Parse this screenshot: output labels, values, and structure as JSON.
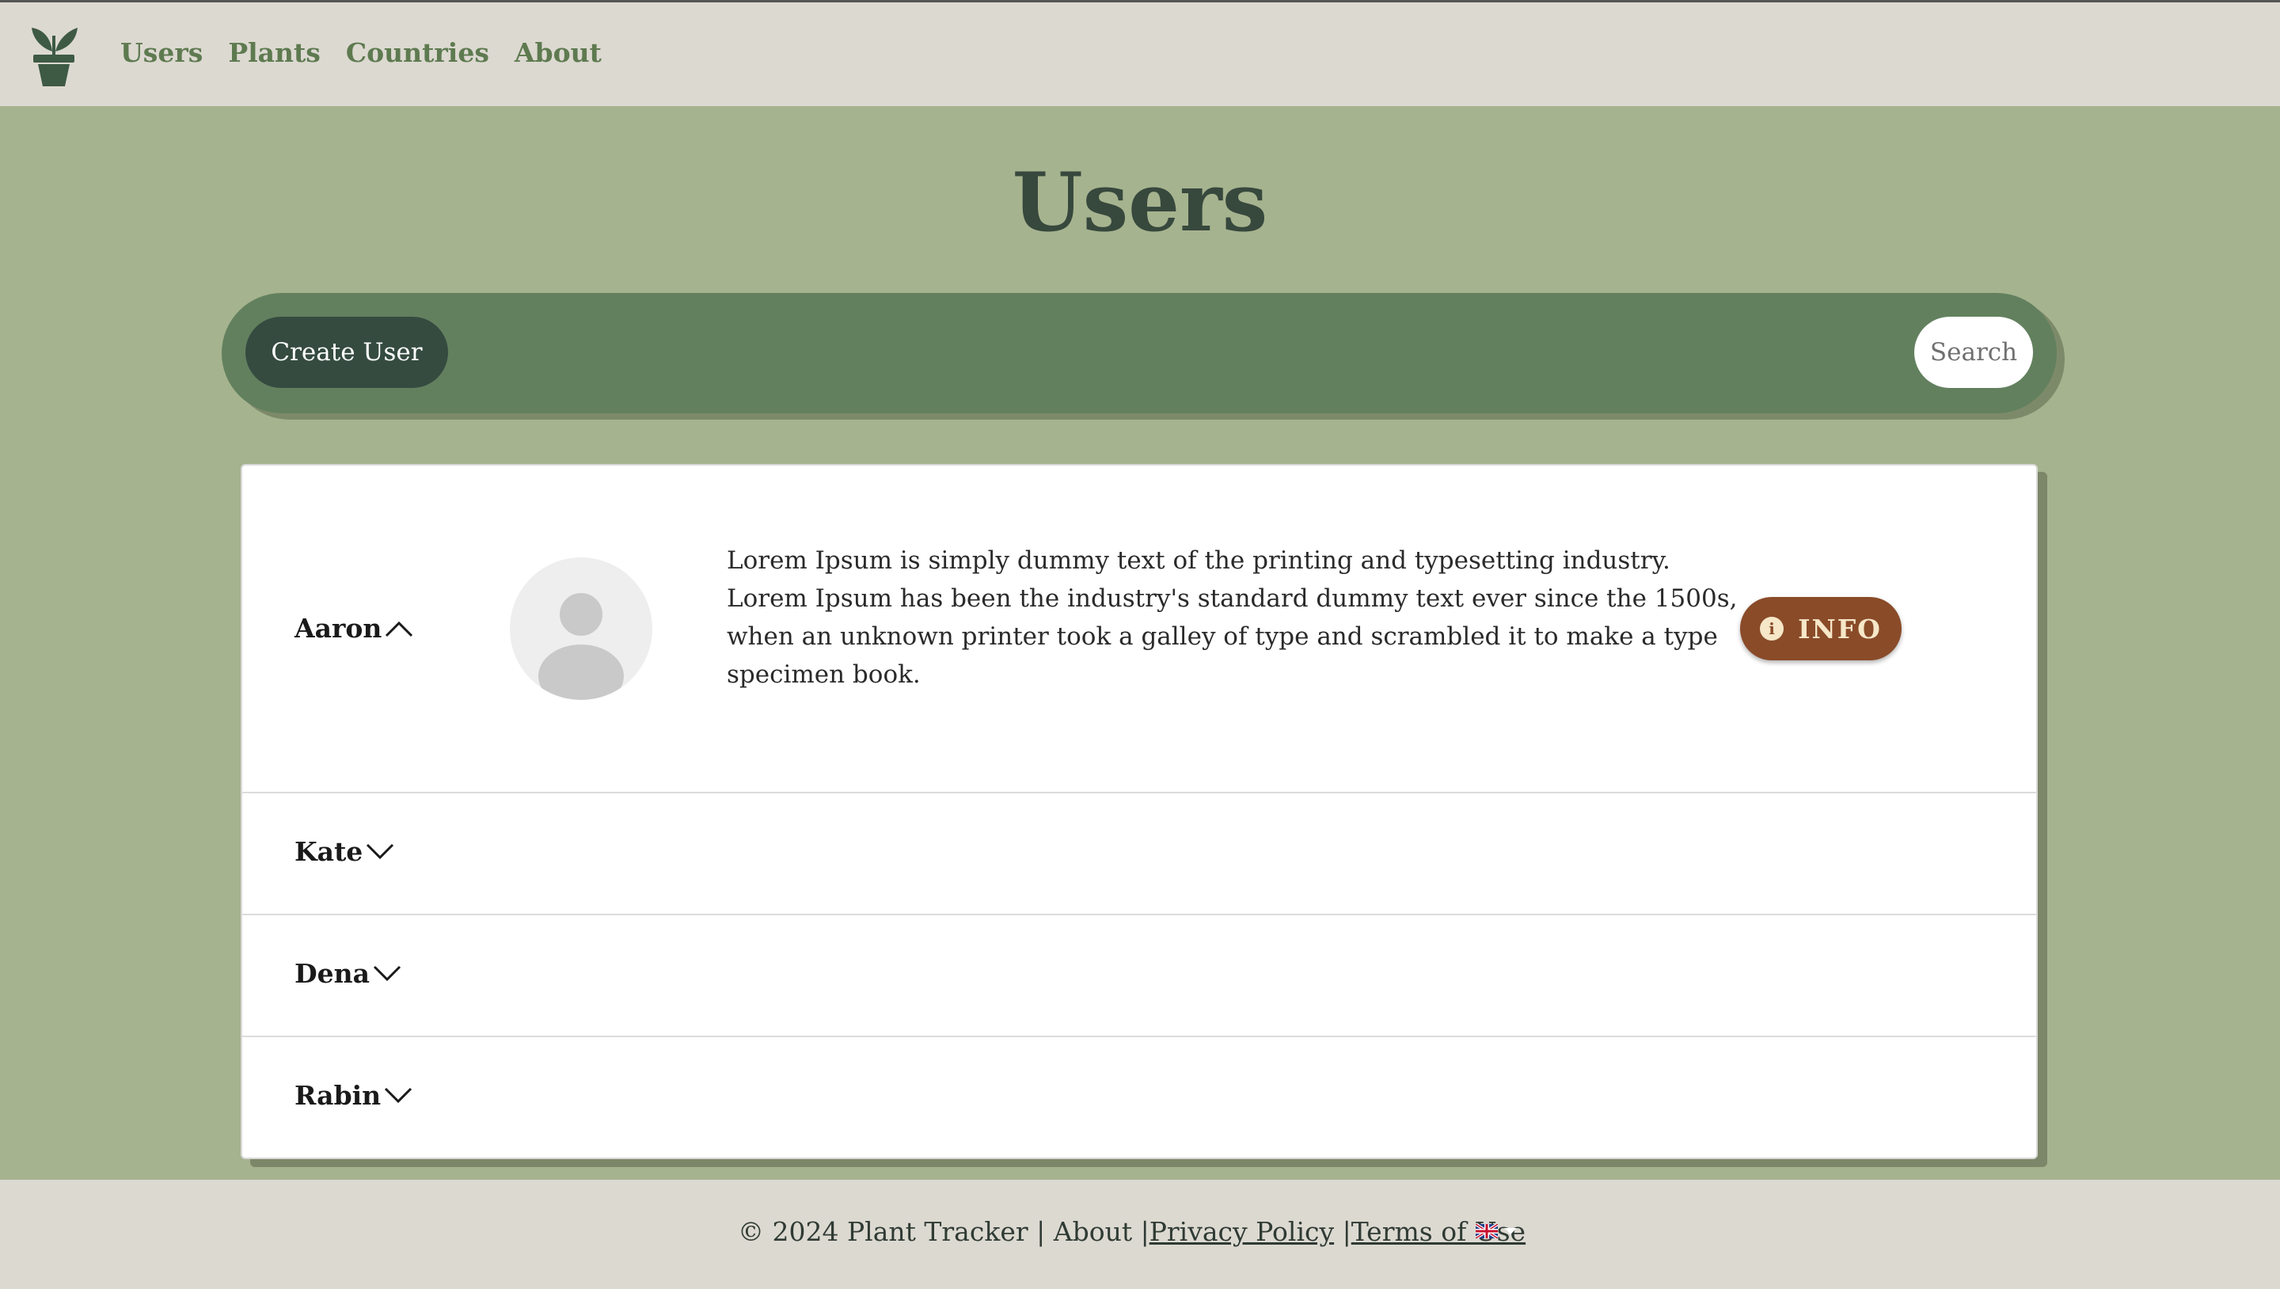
{
  "nav": {
    "logo_icon": "plant-pot-icon",
    "links": [
      {
        "label": "Users"
      },
      {
        "label": "Plants"
      },
      {
        "label": "Countries"
      },
      {
        "label": "About"
      }
    ]
  },
  "page": {
    "title": "Users"
  },
  "toolbar": {
    "create_label": "Create User",
    "search_placeholder": "Search"
  },
  "users": [
    {
      "name": "Aaron",
      "expanded": true,
      "description": "Lorem Ipsum is simply dummy text of the printing and typesetting industry. Lorem Ipsum has been the industry's standard dummy text ever since the 1500s, when an unknown printer took a galley of type and scrambled it to make a type specimen book.",
      "info_label": "INFO"
    },
    {
      "name": "Kate",
      "expanded": false
    },
    {
      "name": "Dena",
      "expanded": false
    },
    {
      "name": "Rabin",
      "expanded": false
    }
  ],
  "footer": {
    "copyright": "© 2024 Plant Tracker | About |",
    "privacy": "Privacy Policy",
    "sep": " |",
    "terms": "Terms of Use",
    "language_icon": "uk-flag-icon"
  },
  "colors": {
    "background": "#a6b38f",
    "navbar": "#dcd9d1",
    "accent_green": "#62805e",
    "dark_green": "#354b40",
    "info_brown": "#8a4b29"
  }
}
